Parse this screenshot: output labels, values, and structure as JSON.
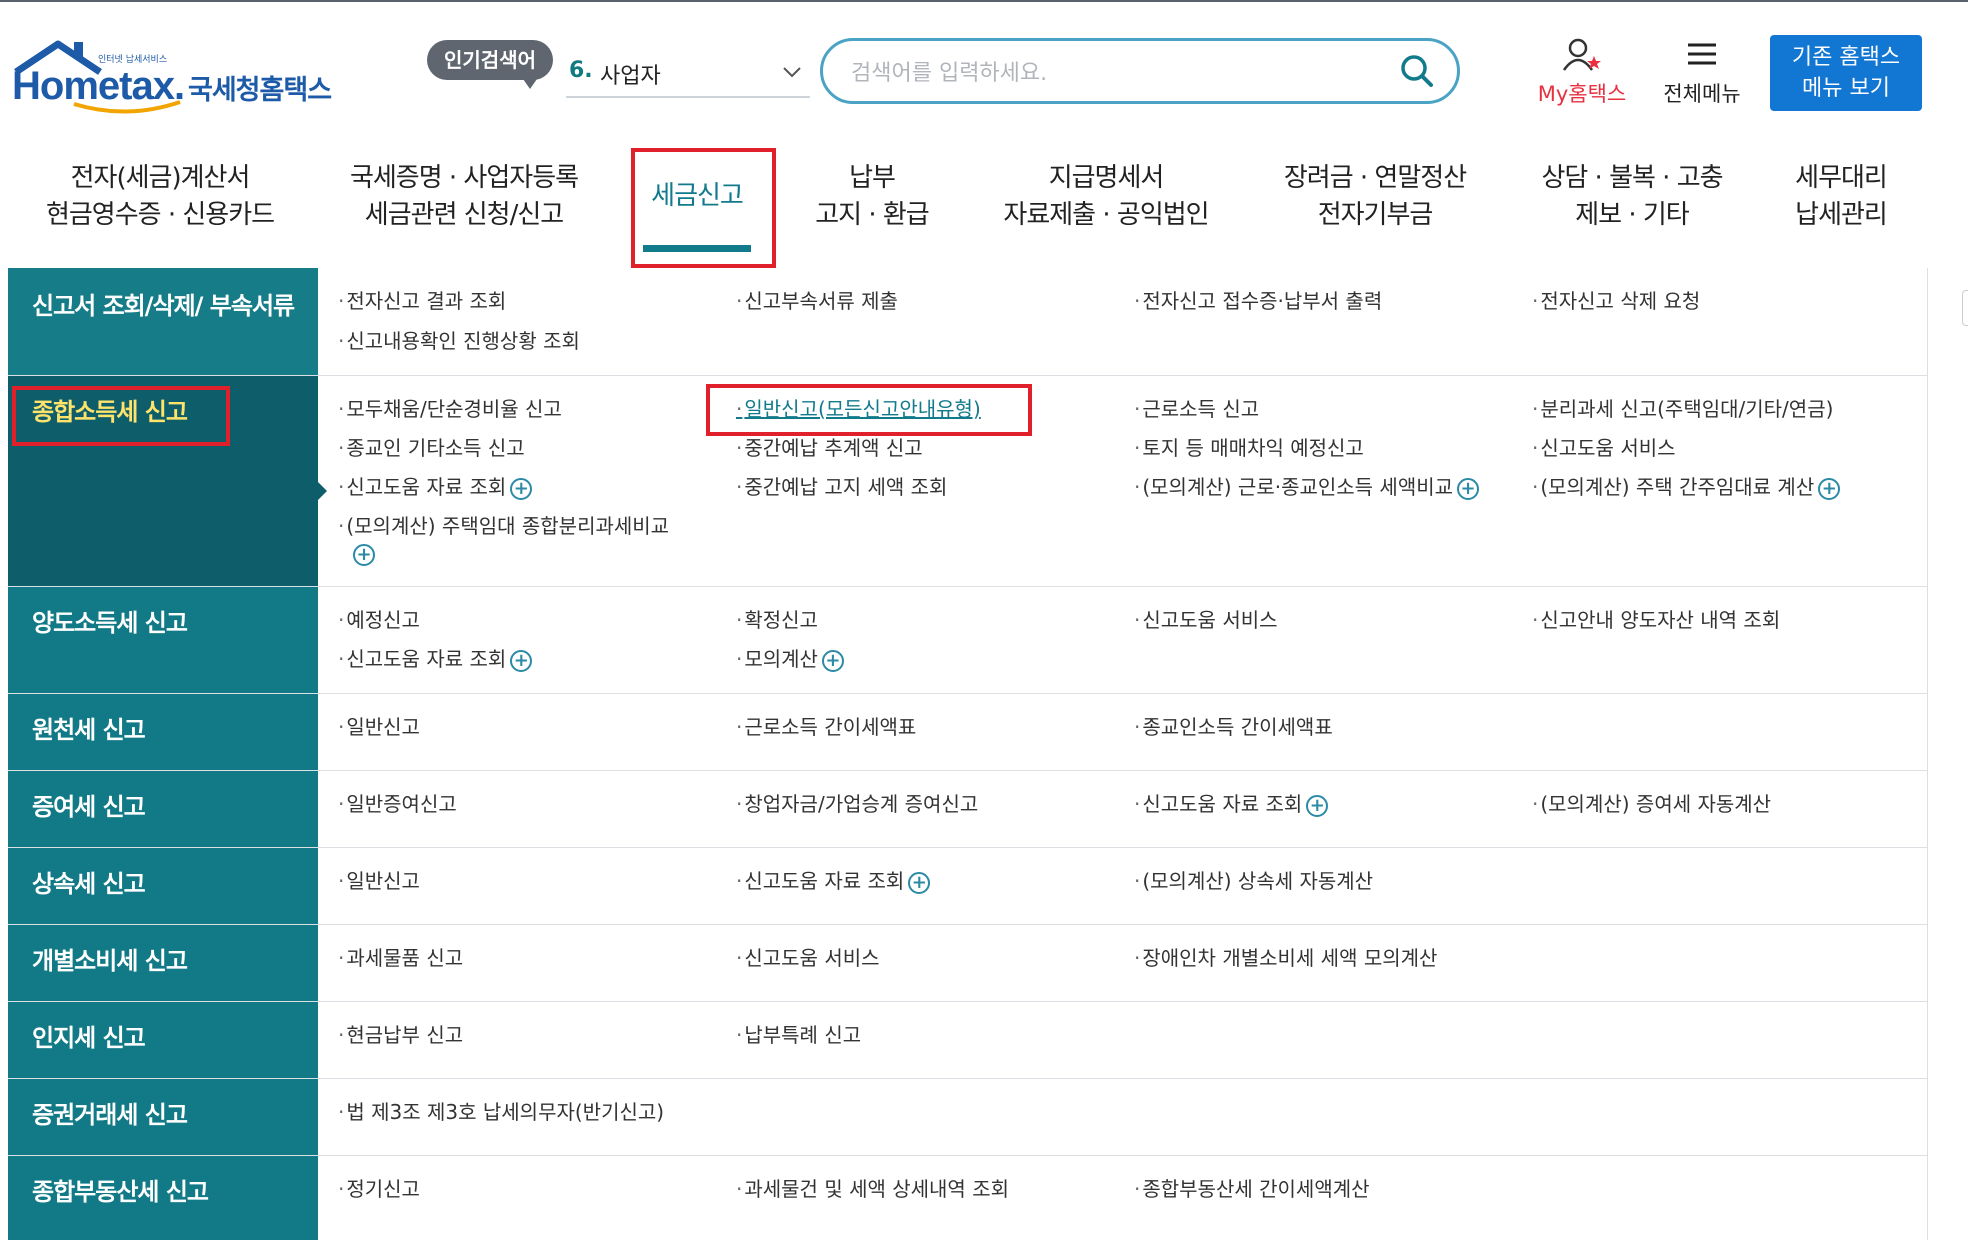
{
  "header": {
    "logo_small": "인터넷 납세서비스",
    "logo_main": "Hometax.",
    "logo_sub": "국세청홈택스",
    "popular_badge": "인기검색어",
    "popular_number": "6.",
    "popular_term": "사업자",
    "search_placeholder": "검색어를 입력하세요.",
    "my_hometax": "My홈택스",
    "all_menu": "전체메뉴",
    "old_menu_line1": "기존 홈택스",
    "old_menu_line2": "메뉴 보기"
  },
  "gnb": [
    {
      "line1": "전자(세금)계산서",
      "line2": "현금영수증 · 신용카드"
    },
    {
      "line1": "국세증명 · 사업자등록",
      "line2": "세금관련 신청/신고"
    },
    {
      "line1": "세금신고",
      "line2": ""
    },
    {
      "line1": "납부",
      "line2": "고지 · 환급"
    },
    {
      "line1": "지급명세서",
      "line2": "자료제출 · 공익법인"
    },
    {
      "line1": "장려금 · 연말정산",
      "line2": "전자기부금"
    },
    {
      "line1": "상담 · 불복 · 고충",
      "line2": "제보 · 기타"
    },
    {
      "line1": "세무대리",
      "line2": "납세관리"
    }
  ],
  "rows": [
    {
      "category": "신고서 조회/삭제/ 부속서류",
      "links": [
        "전자신고 결과 조회",
        "신고부속서류 제출",
        "전자신고 접수증·납부서 출력",
        "전자신고 삭제 요청",
        "신고내용확인 진행상황 조회"
      ]
    },
    {
      "category": "종합소득세 신고",
      "links": [
        "모두채움/단순경비율 신고",
        "일반신고(모든신고안내유형)",
        "근로소득 신고",
        "분리과세 신고(주택임대/기타/연금)",
        "종교인 기타소득 신고",
        "중간예납 추계액 신고",
        "토지 등 매매차익 예정신고",
        "신고도움 서비스",
        "신고도움 자료 조회",
        "중간예납 고지 세액 조회",
        "(모의계산) 근로·종교인소득 세액비교",
        "(모의계산) 주택 간주임대료 계산",
        "(모의계산) 주택임대 종합분리과세비교"
      ]
    },
    {
      "category": "양도소득세 신고",
      "links": [
        "예정신고",
        "확정신고",
        "신고도움 서비스",
        "신고안내 양도자산 내역 조회",
        "신고도움 자료 조회",
        "모의계산"
      ]
    },
    {
      "category": "원천세 신고",
      "links": [
        "일반신고",
        "근로소득 간이세액표",
        "종교인소득 간이세액표"
      ]
    },
    {
      "category": "증여세 신고",
      "links": [
        "일반증여신고",
        "창업자금/가업승계 증여신고",
        "신고도움 자료 조회",
        "(모의계산) 증여세 자동계산"
      ]
    },
    {
      "category": "상속세 신고",
      "links": [
        "일반신고",
        "신고도움 자료 조회",
        "(모의계산) 상속세 자동계산"
      ]
    },
    {
      "category": "개별소비세 신고",
      "links": [
        "과세물품 신고",
        "신고도움 서비스",
        "장애인차 개별소비세 세액 모의계산"
      ]
    },
    {
      "category": "인지세 신고",
      "links": [
        "현금납부 신고",
        "납부특례 신고"
      ]
    },
    {
      "category": "증권거래세 신고",
      "links": [
        "법 제3조 제3호 납세의무자(반기신고)"
      ]
    },
    {
      "category": "종합부동산세 신고",
      "links": [
        "정기신고",
        "과세물건 및 세액 상세내역 조회",
        "종합부동산세 간이세액계산"
      ]
    }
  ],
  "colors": {
    "teal": "#117a86",
    "teal_dark": "#0d5e6a",
    "highlight_red": "#e0202a",
    "accent_blue": "#1276d3",
    "search_border": "#4aa3c4"
  }
}
